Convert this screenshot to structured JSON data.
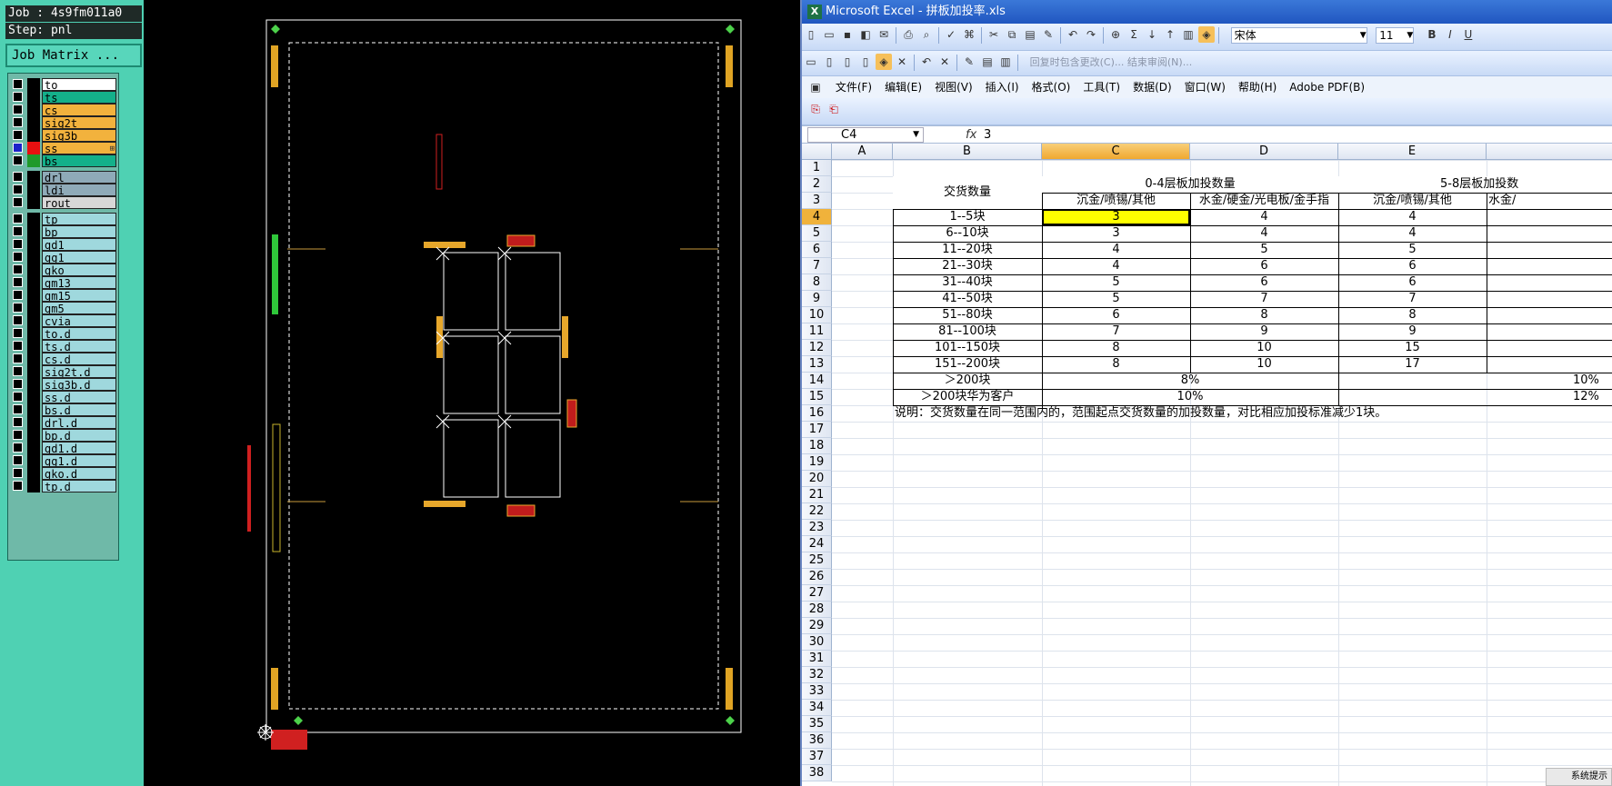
{
  "left_panel": {
    "job_label": "Job : 4s9fm011a0",
    "step_label": "Step: pnl",
    "job_matrix_button": "Job Matrix ...",
    "layers": [
      {
        "name": "to",
        "color": "#ffffff",
        "swatch": "#000000",
        "checked": false
      },
      {
        "name": "ts",
        "color": "#14b08a",
        "swatch": "#000000",
        "checked": false
      },
      {
        "name": "cs",
        "color": "#f2b23d",
        "swatch": "#000000",
        "checked": false
      },
      {
        "name": "sig2t",
        "color": "#f2b23d",
        "swatch": "#000000",
        "checked": false
      },
      {
        "name": "sig3b",
        "color": "#f2b23d",
        "swatch": "#000000",
        "checked": false
      },
      {
        "name": "ss",
        "color": "#f2b23d",
        "swatch": "#e81010",
        "checked": true,
        "marker": "⊞"
      },
      {
        "name": "bs",
        "color": "#14b08a",
        "swatch": "#1f9a2b",
        "checked": false
      },
      {
        "name": "drl",
        "color": "#8faab8",
        "swatch": "#000000",
        "checked": false
      },
      {
        "name": "ldi",
        "color": "#8faab8",
        "swatch": "#000000",
        "checked": false
      },
      {
        "name": "rout",
        "color": "#d7d7d7",
        "swatch": "#000000",
        "checked": false
      },
      {
        "name": "tp",
        "color": "#9fd8dd",
        "swatch": "#000000",
        "checked": false
      },
      {
        "name": "bp",
        "color": "#9fd8dd",
        "swatch": "#000000",
        "checked": false
      },
      {
        "name": "gd1",
        "color": "#9fd8dd",
        "swatch": "#000000",
        "checked": false
      },
      {
        "name": "gg1",
        "color": "#9fd8dd",
        "swatch": "#000000",
        "checked": false
      },
      {
        "name": "gko",
        "color": "#9fd8dd",
        "swatch": "#000000",
        "checked": false
      },
      {
        "name": "gm13",
        "color": "#9fd8dd",
        "swatch": "#000000",
        "checked": false
      },
      {
        "name": "gm15",
        "color": "#9fd8dd",
        "swatch": "#000000",
        "checked": false
      },
      {
        "name": "gm5",
        "color": "#9fd8dd",
        "swatch": "#000000",
        "checked": false
      },
      {
        "name": "cvia",
        "color": "#9fd8dd",
        "swatch": "#000000",
        "checked": false
      },
      {
        "name": "to.d",
        "color": "#9fd8dd",
        "swatch": "#000000",
        "checked": false
      },
      {
        "name": "ts.d",
        "color": "#9fd8dd",
        "swatch": "#000000",
        "checked": false
      },
      {
        "name": "cs.d",
        "color": "#9fd8dd",
        "swatch": "#000000",
        "checked": false
      },
      {
        "name": "sig2t.d",
        "color": "#9fd8dd",
        "swatch": "#000000",
        "checked": false
      },
      {
        "name": "sig3b.d",
        "color": "#9fd8dd",
        "swatch": "#000000",
        "checked": false
      },
      {
        "name": "ss.d",
        "color": "#9fd8dd",
        "swatch": "#000000",
        "checked": false
      },
      {
        "name": "bs.d",
        "color": "#9fd8dd",
        "swatch": "#000000",
        "checked": false
      },
      {
        "name": "drl.d",
        "color": "#9fd8dd",
        "swatch": "#000000",
        "checked": false
      },
      {
        "name": "bp.d",
        "color": "#9fd8dd",
        "swatch": "#000000",
        "checked": false
      },
      {
        "name": "gd1.d",
        "color": "#9fd8dd",
        "swatch": "#000000",
        "checked": false
      },
      {
        "name": "gg1.d",
        "color": "#9fd8dd",
        "swatch": "#000000",
        "checked": false
      },
      {
        "name": "gko.d",
        "color": "#9fd8dd",
        "swatch": "#000000",
        "checked": false
      },
      {
        "name": "tp.d",
        "color": "#9fd8dd",
        "swatch": "#000000",
        "checked": false
      }
    ]
  },
  "excel": {
    "title": "Microsoft Excel - 拼板加投率.xls",
    "toolbar_hint": "回复时包含更改(C)... 结束审阅(N)...",
    "font_name": "宋体",
    "font_size": "11",
    "menu": [
      "文件(F)",
      "编辑(E)",
      "视图(V)",
      "插入(I)",
      "格式(O)",
      "工具(T)",
      "数据(D)",
      "窗口(W)",
      "帮助(H)",
      "Adobe PDF(B)"
    ],
    "name_box": "C4",
    "fx_label": "fx",
    "formula_value": "3",
    "columns": [
      "A",
      "B",
      "C",
      "D",
      "E"
    ],
    "selected_column": "C",
    "selected_row": 4,
    "row_numbers": [
      1,
      2,
      3,
      4,
      5,
      6,
      7,
      8,
      9,
      10,
      11,
      12,
      13,
      14,
      15,
      16,
      17,
      18,
      19,
      20,
      21,
      22,
      23,
      24,
      25,
      26,
      27,
      28,
      29,
      30,
      31,
      32,
      33,
      34,
      35,
      36,
      37,
      38
    ],
    "header": {
      "qty": "交货数量",
      "group1": "0-4层板加投数量",
      "group2": "5-8层板加投数",
      "sub1": "沉金/喷锡/其他",
      "sub2": "水金/硬金/光电板/金手指",
      "sub3": "沉金/喷锡/其他",
      "sub4": "水金/"
    },
    "rows": [
      {
        "qty": "1--5块",
        "c": "3",
        "d": "4",
        "e": "4"
      },
      {
        "qty": "6--10块",
        "c": "3",
        "d": "4",
        "e": "4"
      },
      {
        "qty": "11--20块",
        "c": "4",
        "d": "5",
        "e": "5"
      },
      {
        "qty": "21--30块",
        "c": "4",
        "d": "6",
        "e": "6"
      },
      {
        "qty": "31--40块",
        "c": "5",
        "d": "6",
        "e": "6"
      },
      {
        "qty": "41--50块",
        "c": "5",
        "d": "7",
        "e": "7"
      },
      {
        "qty": "51--80块",
        "c": "6",
        "d": "8",
        "e": "8"
      },
      {
        "qty": "81--100块",
        "c": "7",
        "d": "9",
        "e": "9"
      },
      {
        "qty": "101--150块",
        "c": "8",
        "d": "10",
        "e": "15"
      },
      {
        "qty": "151--200块",
        "c": "8",
        "d": "10",
        "e": "17"
      }
    ],
    "row14": {
      "qty": "＞200块",
      "g1": "8%",
      "g2": "10%"
    },
    "row15": {
      "qty": "＞200块华为客户",
      "g1": "10%",
      "g2": "12%"
    },
    "note": "说明：交货数量在同一范围内的，范围起点交货数量的加投数量，对比相应加投标准减少1块。",
    "tray_label": "系统提示"
  }
}
